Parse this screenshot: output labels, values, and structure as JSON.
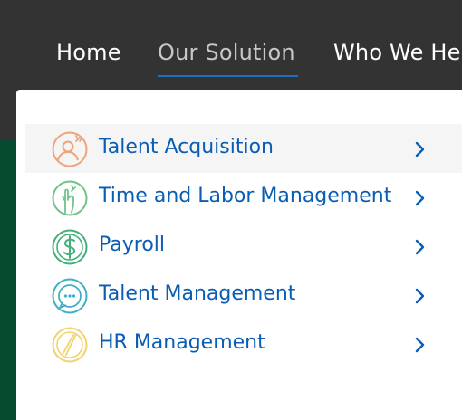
{
  "nav": {
    "items": [
      {
        "label": "Home",
        "active": false
      },
      {
        "label": "Our Solution",
        "active": true
      },
      {
        "label": "Who We He",
        "active": false
      }
    ],
    "active_color": "#1f6fc0"
  },
  "dropdown": {
    "items": [
      {
        "label": "Talent Acquisition",
        "icon": "talent-acquisition-icon",
        "color": "#f0a27a"
      },
      {
        "label": "Time and Labor Management",
        "icon": "time-labor-hand-icon",
        "color": "#6fc28a"
      },
      {
        "label": "Payroll",
        "icon": "payroll-dollar-icon",
        "color": "#42b07a"
      },
      {
        "label": "Talent Management",
        "icon": "talent-management-chat-icon",
        "color": "#3fb0c4"
      },
      {
        "label": "HR Management",
        "icon": "hr-management-compass-icon",
        "color": "#f2d26a"
      }
    ],
    "label_color": "#0a5db4"
  }
}
